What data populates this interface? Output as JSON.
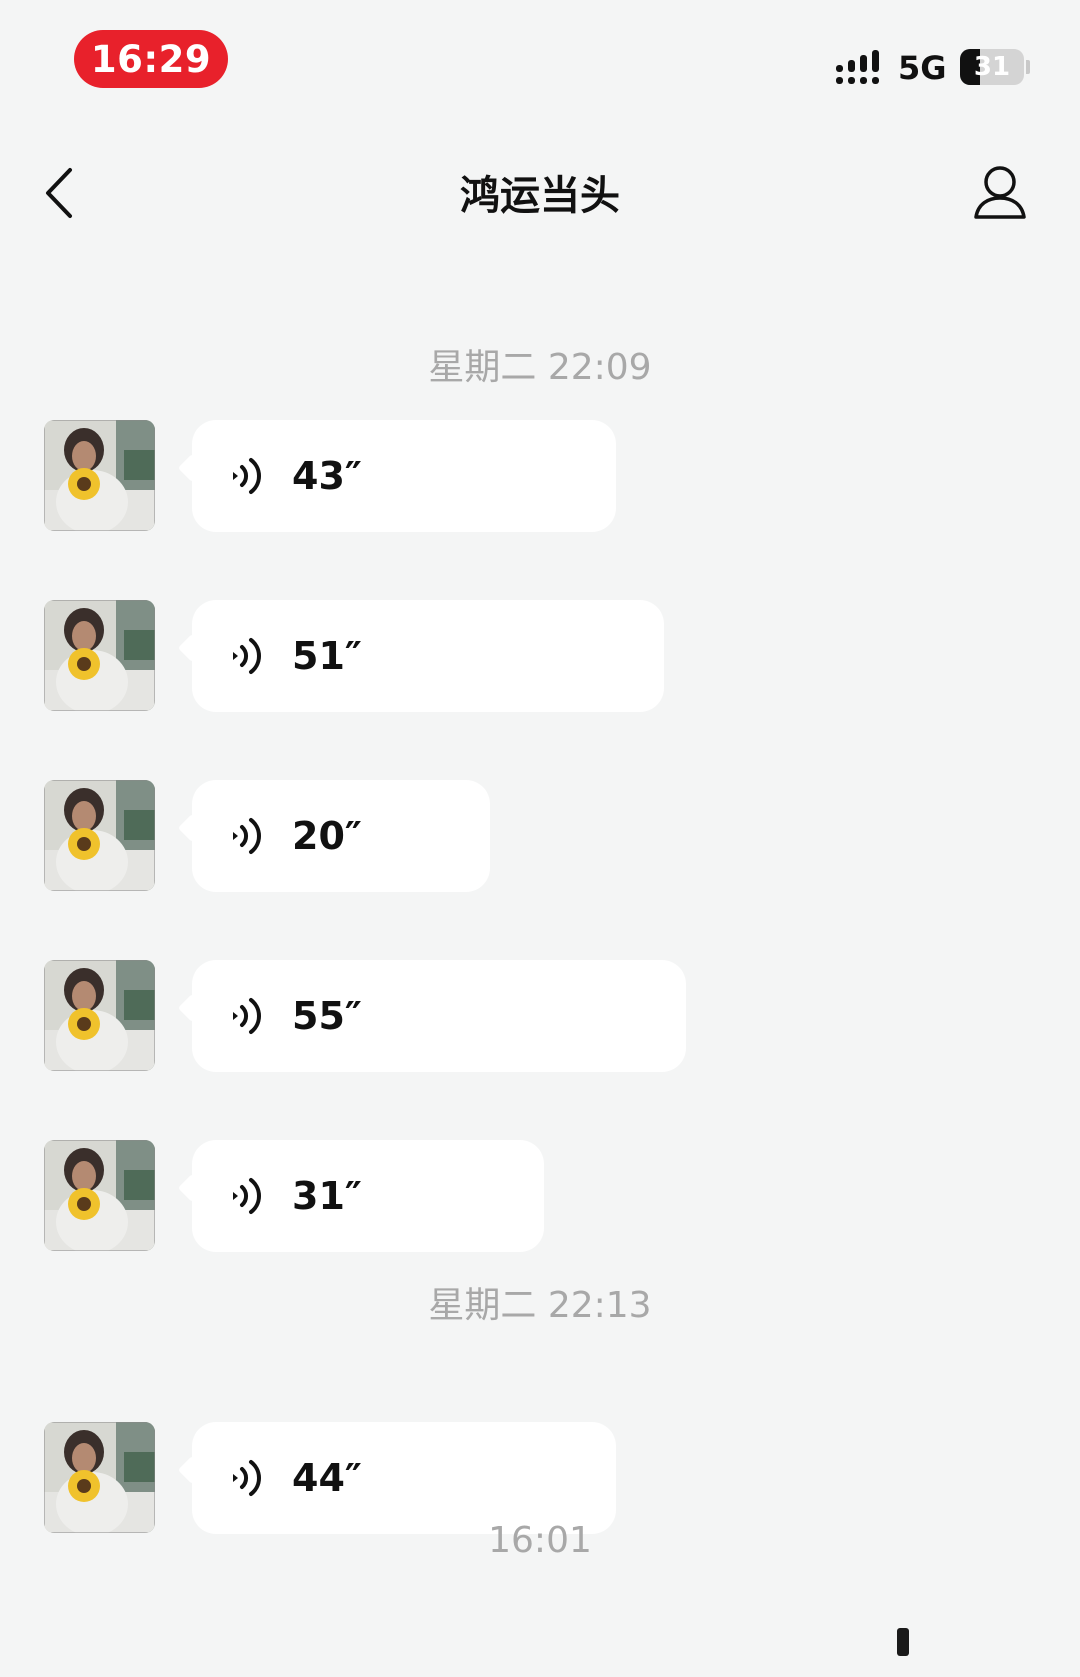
{
  "status_bar": {
    "time": "16:29",
    "network": "5G",
    "battery": "31",
    "battery_level": 0.31,
    "time_pill_color": "#e8212b"
  },
  "nav": {
    "title": "鸿运当头",
    "back_icon": "chevron-left-icon",
    "profile_icon": "person-icon"
  },
  "chat": {
    "groups": [
      {
        "timestamp": "星期二 22:09",
        "messages": [
          {
            "type": "voice",
            "duration": "43″",
            "seconds": 43
          },
          {
            "type": "voice",
            "duration": "51″",
            "seconds": 51
          },
          {
            "type": "voice",
            "duration": "20″",
            "seconds": 20
          },
          {
            "type": "voice",
            "duration": "55″",
            "seconds": 55
          },
          {
            "type": "voice",
            "duration": "31″",
            "seconds": 31
          }
        ]
      },
      {
        "timestamp": "星期二 22:13",
        "messages": [
          {
            "type": "voice",
            "duration": "44″",
            "seconds": 44
          }
        ]
      },
      {
        "timestamp": "16:01",
        "messages": []
      }
    ]
  },
  "colors": {
    "background": "#f4f5f5",
    "bubble": "#ffffff",
    "timestamp_text": "#a8a8a8"
  }
}
